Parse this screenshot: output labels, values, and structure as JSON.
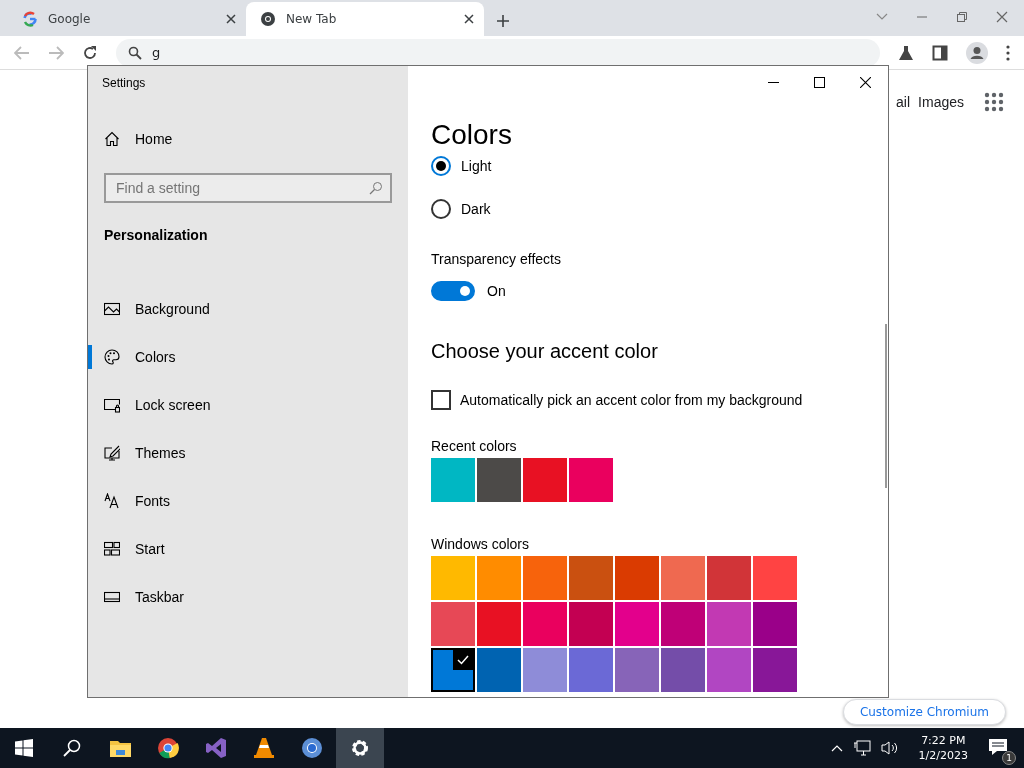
{
  "browser": {
    "tabs": [
      {
        "title": "Google",
        "selected": false
      },
      {
        "title": "New Tab",
        "selected": true
      }
    ],
    "address": {
      "value": "g"
    },
    "page": {
      "links": [
        "ail",
        "Images"
      ],
      "customize_button": "Customize Chromium"
    }
  },
  "settings": {
    "title": "Settings",
    "home": "Home",
    "search": {
      "placeholder": "Find a setting"
    },
    "section": "Personalization",
    "nav": [
      {
        "label": "Background",
        "selected": false
      },
      {
        "label": "Colors",
        "selected": true
      },
      {
        "label": "Lock screen",
        "selected": false
      },
      {
        "label": "Themes",
        "selected": false
      },
      {
        "label": "Fonts",
        "selected": false
      },
      {
        "label": "Start",
        "selected": false
      },
      {
        "label": "Taskbar",
        "selected": false
      }
    ],
    "page_title": "Colors",
    "modes": [
      {
        "label": "Light",
        "selected": true
      },
      {
        "label": "Dark",
        "selected": false
      }
    ],
    "transparency": {
      "label": "Transparency effects",
      "on": true,
      "state_text": "On"
    },
    "accent_heading": "Choose your accent color",
    "auto_pick": {
      "label": "Automatically pick an accent color from my background",
      "checked": false
    },
    "recent": {
      "label": "Recent colors",
      "swatches": [
        {
          "color": "#00b7c3",
          "selected": false
        },
        {
          "color": "#4c4a48",
          "selected": false
        },
        {
          "color": "#e81123",
          "selected": false
        },
        {
          "color": "#ea005e",
          "selected": false
        }
      ]
    },
    "windows_colors": {
      "label": "Windows colors",
      "swatches": [
        {
          "color": "#ffb900",
          "selected": false
        },
        {
          "color": "#ff8c00",
          "selected": false
        },
        {
          "color": "#f7630c",
          "selected": false
        },
        {
          "color": "#ca5010",
          "selected": false
        },
        {
          "color": "#da3b01",
          "selected": false
        },
        {
          "color": "#ef6950",
          "selected": false
        },
        {
          "color": "#d13438",
          "selected": false
        },
        {
          "color": "#ff4343",
          "selected": false
        },
        {
          "color": "#e74856",
          "selected": false
        },
        {
          "color": "#e81123",
          "selected": false
        },
        {
          "color": "#ea005e",
          "selected": false
        },
        {
          "color": "#c30052",
          "selected": false
        },
        {
          "color": "#e3008c",
          "selected": false
        },
        {
          "color": "#bf0077",
          "selected": false
        },
        {
          "color": "#c239b3",
          "selected": false
        },
        {
          "color": "#9a0089",
          "selected": false
        },
        {
          "color": "#0078d7",
          "selected": true
        },
        {
          "color": "#0063b1",
          "selected": false
        },
        {
          "color": "#8e8cd8",
          "selected": false
        },
        {
          "color": "#6b69d6",
          "selected": false
        },
        {
          "color": "#8764b8",
          "selected": false
        },
        {
          "color": "#744da9",
          "selected": false
        },
        {
          "color": "#b146c2",
          "selected": false
        },
        {
          "color": "#881798",
          "selected": false
        }
      ]
    }
  },
  "taskbar": {
    "apps": [
      {
        "active": false
      },
      {
        "active": false
      },
      {
        "active": false
      },
      {
        "active": false
      },
      {
        "active": false
      },
      {
        "active": true
      }
    ],
    "time": "7:22 PM",
    "date": "1/2/2023",
    "notification_count": "1"
  }
}
